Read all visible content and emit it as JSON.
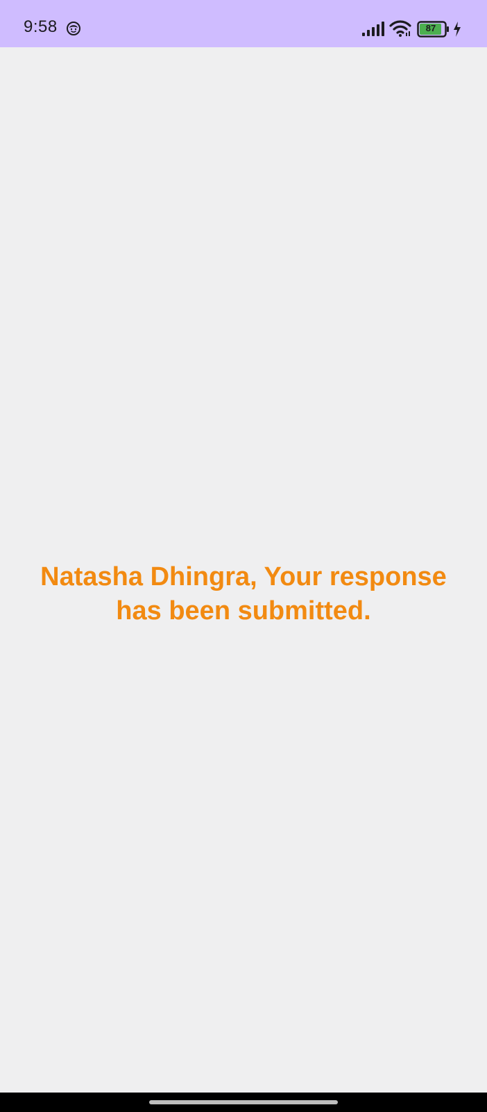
{
  "status_bar": {
    "time": "9:58",
    "battery_level": "87",
    "icons": {
      "face": "face-icon",
      "signal": "signal-icon",
      "wifi": "wifi-icon",
      "battery": "battery-icon",
      "charging": "charging-icon"
    },
    "background_color": "#cfbcff"
  },
  "main": {
    "message": "Natasha Dhingra, Your response has been submitted.",
    "message_color": "#f28a11",
    "background_color": "#efeff0"
  },
  "navigation_bar": {
    "home_indicator": "home-indicator"
  }
}
